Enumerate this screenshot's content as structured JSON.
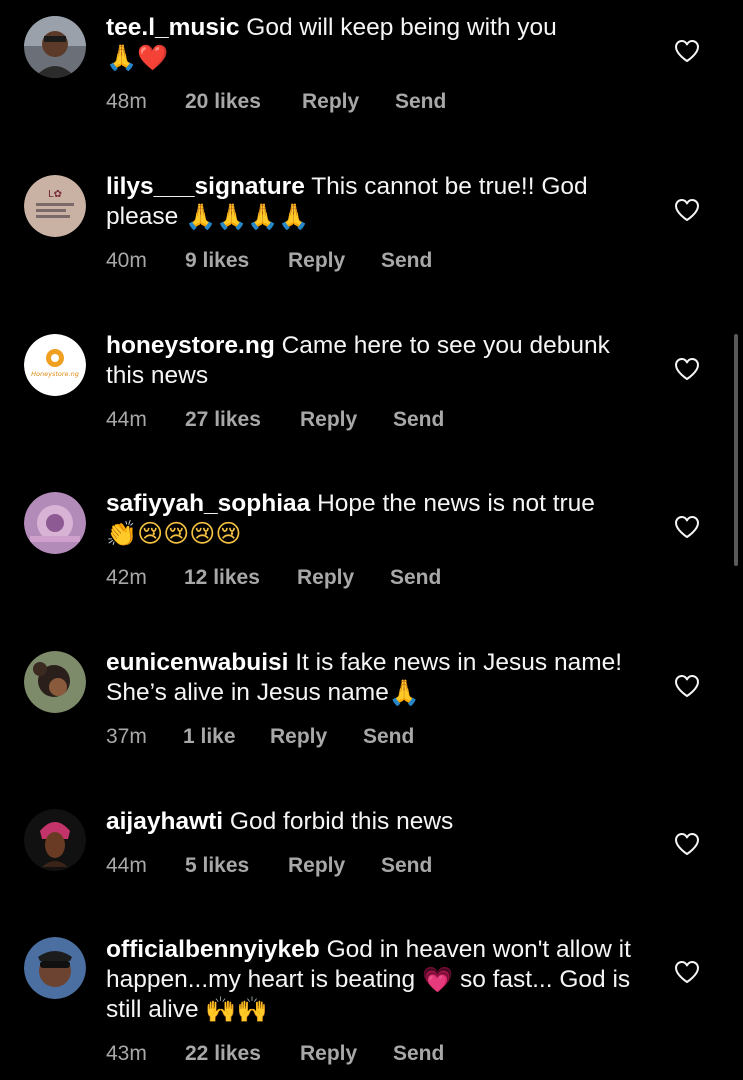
{
  "comments": [
    {
      "username": "tee.l_music",
      "text": "God will keep being with you",
      "emoji_line": "🙏❤️",
      "time": "48m",
      "likes": "20 likes",
      "reply": "Reply",
      "send": "Send"
    },
    {
      "username": "lilys___signature",
      "text": "This cannot be true!! God please",
      "emoji_line": "🙏🙏🙏🙏",
      "time": "40m",
      "likes": "9 likes",
      "reply": "Reply",
      "send": "Send"
    },
    {
      "username": "honeystore.ng",
      "text": "Came here to see you debunk this news",
      "avatar_text": "Honeystore.ng",
      "time": "44m",
      "likes": "27 likes",
      "reply": "Reply",
      "send": "Send"
    },
    {
      "username": "safiyyah_sophiaa",
      "text": "Hope the news is not true",
      "emoji_line": "👏😢😢😢😢",
      "time": "42m",
      "likes": "12 likes",
      "reply": "Reply",
      "send": "Send"
    },
    {
      "username": "eunicenwabuisi",
      "text": "It is fake news in Jesus name! She’s alive in Jesus name",
      "emoji_line": "🙏",
      "time": "37m",
      "likes": "1 like",
      "reply": "Reply",
      "send": "Send"
    },
    {
      "username": "aijayhawti",
      "text": "God forbid this news",
      "time": "44m",
      "likes": "5 likes",
      "reply": "Reply",
      "send": "Send"
    },
    {
      "username": "officialbennyiykeb",
      "text": "God in heaven won't allow it happen...my heart is beating",
      "emoji_mid": "💗",
      "text_after": "so fast... God is still alive",
      "emoji_line": "🙌🙌",
      "time": "43m",
      "likes": "22 likes",
      "reply": "Reply",
      "send": "Send"
    }
  ],
  "icons": {
    "like": "heart-outline-icon"
  },
  "colors": {
    "background": "#000000",
    "text": "#f5f5f5",
    "meta": "#a8a8a8",
    "heart_red": "#e0245e",
    "pray_yellow": "#f5c242",
    "pink": "#e4478f"
  }
}
